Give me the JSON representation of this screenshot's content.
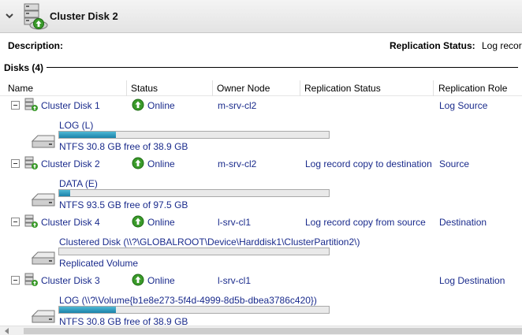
{
  "header": {
    "title": "Cluster Disk 2"
  },
  "info": {
    "description_label": "Description:",
    "replication_status_label": "Replication Status:",
    "replication_status_value": "Log record"
  },
  "section": {
    "title": "Disks (4)"
  },
  "columns": {
    "name": "Name",
    "status": "Status",
    "owner_node": "Owner Node",
    "replication_status": "Replication Status",
    "replication_role": "Replication Role"
  },
  "disks": [
    {
      "name": "Cluster Disk 1",
      "status": "Online",
      "owner": "m-srv-cl2",
      "replication_status": "",
      "role": "Log Source",
      "volume": "LOG (L)",
      "info": "NTFS 30.8 GB free of 38.9 GB",
      "used_fraction": 0.21
    },
    {
      "name": "Cluster Disk 2",
      "status": "Online",
      "owner": "m-srv-cl2",
      "replication_status": "Log record copy to destination",
      "role": "Source",
      "volume": "DATA (E)",
      "info": "NTFS 93.5 GB free of 97.5 GB",
      "used_fraction": 0.04
    },
    {
      "name": "Cluster Disk 4",
      "status": "Online",
      "owner": "l-srv-cl1",
      "replication_status": "Log record copy from source",
      "role": "Destination",
      "volume": "Clustered Disk (\\\\?\\GLOBALROOT\\Device\\Harddisk1\\ClusterPartition2\\)",
      "info": "Replicated Volume",
      "used_fraction": 0
    },
    {
      "name": "Cluster Disk 3",
      "status": "Online",
      "owner": "l-srv-cl1",
      "replication_status": "",
      "role": "Log Destination",
      "volume": "LOG (\\\\?\\Volume{b1e8e273-5f4d-4999-8d5b-dbea3786c420})",
      "info": "NTFS 30.8 GB free of 38.9 GB",
      "used_fraction": 0.21
    }
  ],
  "colors": {
    "link_text": "#1a2b8c",
    "bar_fill": "#2a93bd",
    "online_green": "#3a9a2a"
  },
  "icons": {
    "collapse": "chevron-down-icon",
    "cluster_disk": "cluster-disk-icon",
    "expand_toggle": "minus-toggle-icon",
    "online": "online-arrow-icon",
    "volume": "hard-drive-icon"
  }
}
